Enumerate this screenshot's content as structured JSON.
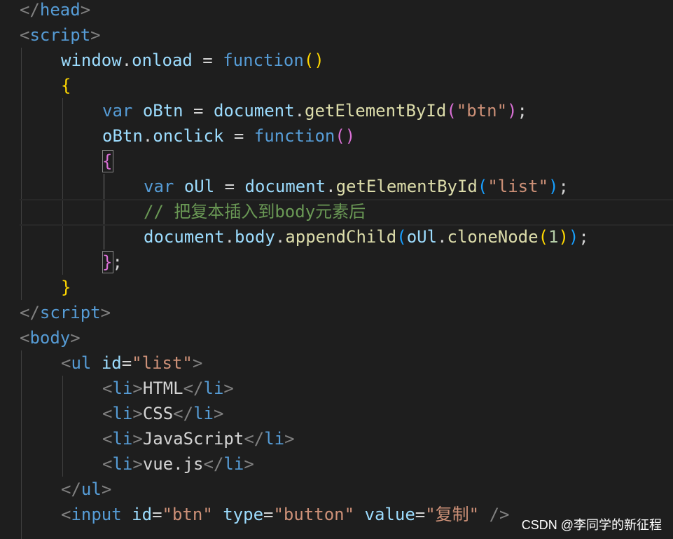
{
  "editor": {
    "theme": {
      "background": "#1e1e1e",
      "tag_bracket": "#808080",
      "tag_name": "#569cd6",
      "attribute": "#9cdcfe",
      "string": "#ce9178",
      "keyword": "#569cd6",
      "variable": "#9cdcfe",
      "function": "#dcdcaa",
      "number": "#b5cea8",
      "comment": "#6a9955",
      "bracket_level_1": "#ffd700",
      "bracket_level_2": "#da70d6",
      "bracket_level_3": "#179fff"
    },
    "lines": [
      [
        [
          "t-tag",
          "</"
        ],
        [
          "t-el",
          "head"
        ],
        [
          "t-tag",
          ">"
        ]
      ],
      [
        [
          "t-tag",
          "<"
        ],
        [
          "t-el",
          "script"
        ],
        [
          "t-tag",
          ">"
        ]
      ],
      [
        [
          "t-var",
          "window"
        ],
        [
          "t-txt",
          "."
        ],
        [
          "t-var",
          "onload"
        ],
        [
          "t-txt",
          " = "
        ],
        [
          "t-kw",
          "function"
        ],
        [
          "t-p1",
          "()"
        ]
      ],
      [
        [
          "t-p1",
          "{"
        ]
      ],
      [
        [
          "t-kw",
          "var"
        ],
        [
          "t-txt",
          " "
        ],
        [
          "t-var",
          "oBtn"
        ],
        [
          "t-txt",
          " = "
        ],
        [
          "t-var",
          "document"
        ],
        [
          "t-txt",
          "."
        ],
        [
          "t-fn",
          "getElementById"
        ],
        [
          "t-p2",
          "("
        ],
        [
          "t-str",
          "\"btn\""
        ],
        [
          "t-p2",
          ")"
        ],
        [
          "t-txt",
          ";"
        ]
      ],
      [
        [
          "t-var",
          "oBtn"
        ],
        [
          "t-txt",
          "."
        ],
        [
          "t-var",
          "onclick"
        ],
        [
          "t-txt",
          " = "
        ],
        [
          "t-kw",
          "function"
        ],
        [
          "t-p2",
          "()"
        ]
      ],
      [
        [
          "t-p2",
          "{"
        ]
      ],
      [
        [
          "t-kw",
          "var"
        ],
        [
          "t-txt",
          " "
        ],
        [
          "t-var",
          "oUl"
        ],
        [
          "t-txt",
          " = "
        ],
        [
          "t-var",
          "document"
        ],
        [
          "t-txt",
          "."
        ],
        [
          "t-fn",
          "getElementById"
        ],
        [
          "t-p3",
          "("
        ],
        [
          "t-str",
          "\"list\""
        ],
        [
          "t-p3",
          ")"
        ],
        [
          "t-txt",
          ";"
        ]
      ],
      [
        [
          "t-com",
          "// 把复本插入到body元素后"
        ]
      ],
      [
        [
          "t-var",
          "document"
        ],
        [
          "t-txt",
          "."
        ],
        [
          "t-var",
          "body"
        ],
        [
          "t-txt",
          "."
        ],
        [
          "t-fn",
          "appendChild"
        ],
        [
          "t-p3",
          "("
        ],
        [
          "t-var",
          "oUl"
        ],
        [
          "t-txt",
          "."
        ],
        [
          "t-fn",
          "cloneNode"
        ],
        [
          "t-p1",
          "("
        ],
        [
          "t-num",
          "1"
        ],
        [
          "t-p1",
          ")"
        ],
        [
          "t-p3",
          ")"
        ],
        [
          "t-txt",
          ";"
        ]
      ],
      [
        [
          "t-p2",
          "}"
        ],
        [
          "t-txt",
          ";"
        ]
      ],
      [
        [
          "t-p1",
          "}"
        ]
      ],
      [
        [
          "t-tag",
          "</"
        ],
        [
          "t-el",
          "script"
        ],
        [
          "t-tag",
          ">"
        ]
      ],
      [
        [
          "t-tag",
          "<"
        ],
        [
          "t-el",
          "body"
        ],
        [
          "t-tag",
          ">"
        ]
      ],
      [
        [
          "t-tag",
          "<"
        ],
        [
          "t-el",
          "ul"
        ],
        [
          "t-txt",
          " "
        ],
        [
          "t-attr",
          "id"
        ],
        [
          "t-txt",
          "="
        ],
        [
          "t-str",
          "\"list\""
        ],
        [
          "t-tag",
          ">"
        ]
      ],
      [
        [
          "t-tag",
          "<"
        ],
        [
          "t-el",
          "li"
        ],
        [
          "t-tag",
          ">"
        ],
        [
          "t-txt",
          "HTML"
        ],
        [
          "t-tag",
          "</"
        ],
        [
          "t-el",
          "li"
        ],
        [
          "t-tag",
          ">"
        ]
      ],
      [
        [
          "t-tag",
          "<"
        ],
        [
          "t-el",
          "li"
        ],
        [
          "t-tag",
          ">"
        ],
        [
          "t-txt",
          "CSS"
        ],
        [
          "t-tag",
          "</"
        ],
        [
          "t-el",
          "li"
        ],
        [
          "t-tag",
          ">"
        ]
      ],
      [
        [
          "t-tag",
          "<"
        ],
        [
          "t-el",
          "li"
        ],
        [
          "t-tag",
          ">"
        ],
        [
          "t-txt",
          "JavaScript"
        ],
        [
          "t-tag",
          "</"
        ],
        [
          "t-el",
          "li"
        ],
        [
          "t-tag",
          ">"
        ]
      ],
      [
        [
          "t-tag",
          "<"
        ],
        [
          "t-el",
          "li"
        ],
        [
          "t-tag",
          ">"
        ],
        [
          "t-txt",
          "vue.js"
        ],
        [
          "t-tag",
          "</"
        ],
        [
          "t-el",
          "li"
        ],
        [
          "t-tag",
          ">"
        ]
      ],
      [
        [
          "t-tag",
          "</"
        ],
        [
          "t-el",
          "ul"
        ],
        [
          "t-tag",
          ">"
        ]
      ],
      [
        [
          "t-tag",
          "<"
        ],
        [
          "t-el",
          "input"
        ],
        [
          "t-txt",
          " "
        ],
        [
          "t-attr",
          "id"
        ],
        [
          "t-txt",
          "="
        ],
        [
          "t-str",
          "\"btn\""
        ],
        [
          "t-txt",
          " "
        ],
        [
          "t-attr",
          "type"
        ],
        [
          "t-txt",
          "="
        ],
        [
          "t-str",
          "\"button\""
        ],
        [
          "t-txt",
          " "
        ],
        [
          "t-attr",
          "value"
        ],
        [
          "t-txt",
          "="
        ],
        [
          "t-str",
          "\"复制\""
        ],
        [
          "t-txt",
          " "
        ],
        [
          "t-tag",
          "/>"
        ]
      ]
    ]
  },
  "watermark": "CSDN @李同学的新征程"
}
